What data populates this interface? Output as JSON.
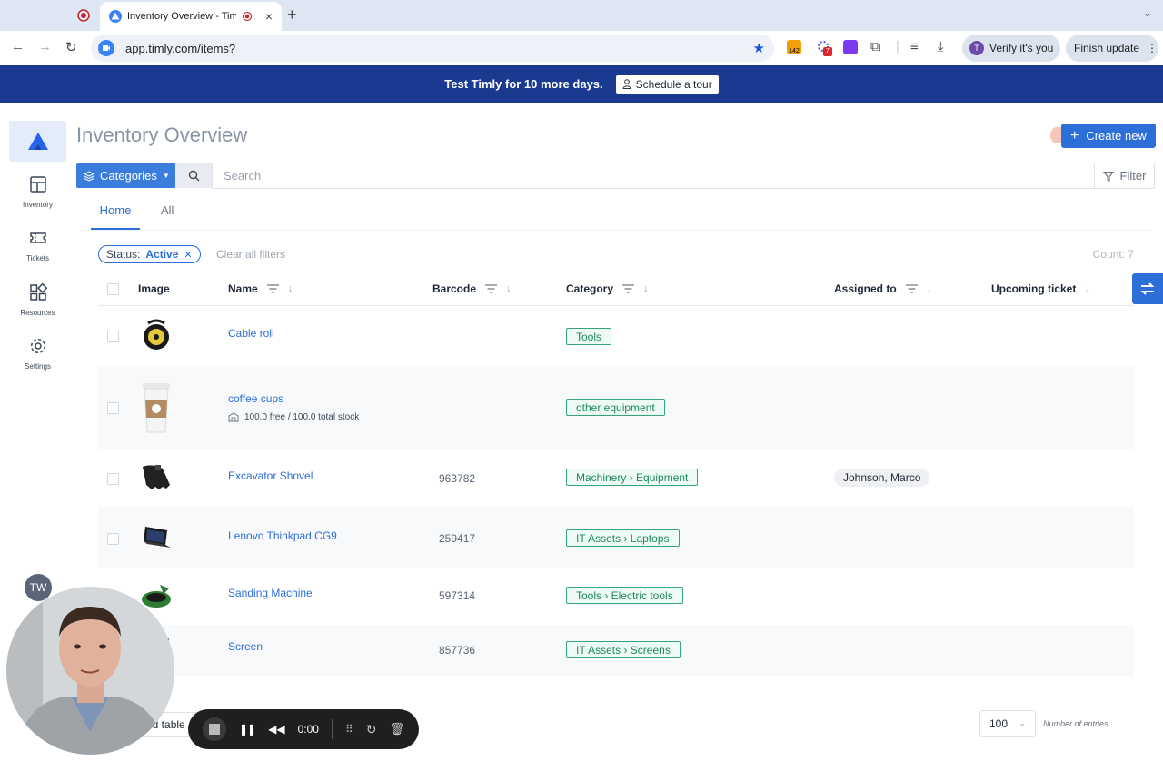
{
  "browser": {
    "tab_title": "Inventory Overview - Timly",
    "url": "app.timly.com/items?",
    "ext_badge_1": "142",
    "ext_badge_2": "7",
    "verify_label": "Verify it's you",
    "verify_avatar": "T",
    "finish_label": "Finish update"
  },
  "banner": {
    "text": "Test Timly for 10 more days.",
    "tour_label": "Schedule a tour"
  },
  "sidebar": {
    "items": [
      {
        "label": "Inventory",
        "icon": "grid-icon"
      },
      {
        "label": "Tickets",
        "icon": "ticket-icon"
      },
      {
        "label": "Resources",
        "icon": "resources-icon"
      },
      {
        "label": "Settings",
        "icon": "gear-icon"
      }
    ]
  },
  "main": {
    "title": "Inventory Overview",
    "create_label": "Create new",
    "categories_label": "Categories",
    "search_placeholder": "Search",
    "filter_label": "Filter",
    "tabs": [
      {
        "label": "Home"
      },
      {
        "label": "All"
      }
    ],
    "filter_chip": {
      "key": "Status:",
      "value": "Active"
    },
    "clear_filters": "Clear all filters",
    "count": "Count: 7"
  },
  "table": {
    "columns": [
      "Image",
      "Name",
      "Barcode",
      "Category",
      "Assigned to",
      "Upcoming ticket"
    ],
    "rows": [
      {
        "name": "Cable roll",
        "barcode": "",
        "category": "Tools",
        "assigned": ""
      },
      {
        "name": "coffee cups",
        "sub": "100.0 free / 100.0 total stock",
        "barcode": "",
        "category": "other equipment",
        "assigned": ""
      },
      {
        "name": "Excavator Shovel",
        "barcode": "963782",
        "category": "Machinery › Equipment",
        "assigned": "Johnson, Marco"
      },
      {
        "name": "Lenovo Thinkpad CG9",
        "barcode": "259417",
        "category": "IT Assets › Laptops",
        "assigned": ""
      },
      {
        "name": "Sanding Machine",
        "barcode": "597314",
        "category": "Tools › Electric tools",
        "assigned": ""
      },
      {
        "name": "Screen",
        "barcode": "857736",
        "category": "IT Assets › Screens",
        "assigned": ""
      }
    ]
  },
  "footer": {
    "expand_label": "nd table",
    "entries_value": "100",
    "entries_label": "Number of entries"
  },
  "user": {
    "initials": "TW"
  },
  "recorder": {
    "time": "0:00"
  },
  "colors": {
    "accent": "#2d6fd8",
    "banner": "#1a3a8f",
    "tag_green": "#1f8a5f"
  }
}
